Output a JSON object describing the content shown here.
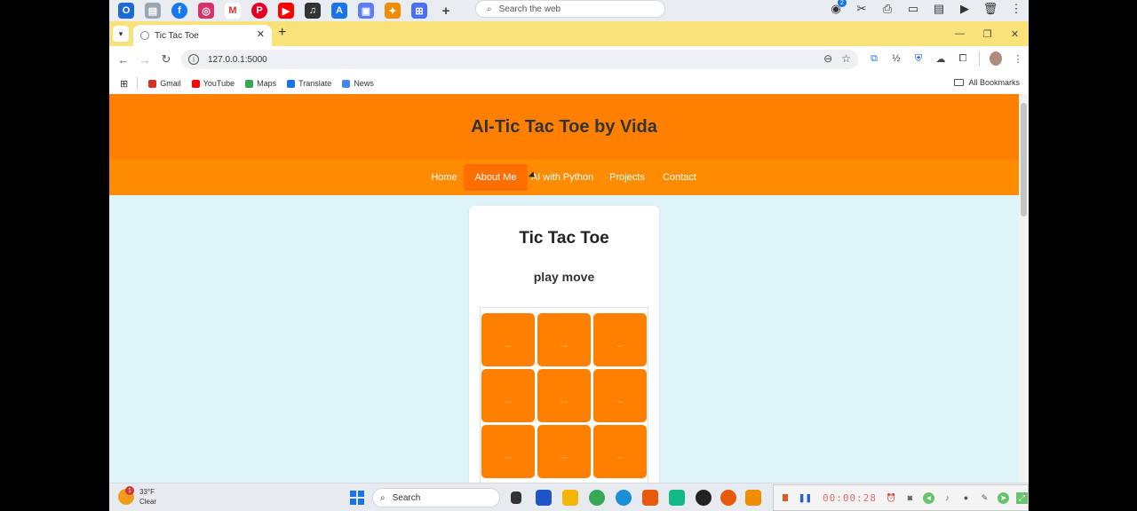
{
  "taskbar_top": {
    "search_placeholder": "Search the web",
    "notif_count": "2"
  },
  "browser": {
    "tab_title": "Tic Tac Toe",
    "url": "127.0.0.1:5000",
    "bookmarks": [
      "Gmail",
      "YouTube",
      "Maps",
      "Translate",
      "News"
    ],
    "all_bookmarks": "All Bookmarks"
  },
  "site": {
    "title": "AI-Tic Tac Toe by Vida",
    "nav": [
      "Home",
      "About Me",
      "AI with Python",
      "Projects",
      "Contact"
    ],
    "active_nav": "About Me"
  },
  "game": {
    "title": "Tic Tac Toe",
    "status": "play move",
    "cells": [
      "_",
      "_",
      "_",
      "_",
      "_",
      "_",
      "_",
      "_",
      "_"
    ]
  },
  "colors": {
    "header": "#ff8000",
    "nav": "#ff8c00",
    "cell": "#ff7f00",
    "page_bg": "#dff4f8"
  },
  "os_taskbar": {
    "temperature": "33°F",
    "condition": "Clear",
    "weather_badge": "1",
    "search_label": "Search",
    "rec_time": "00:00:28"
  }
}
